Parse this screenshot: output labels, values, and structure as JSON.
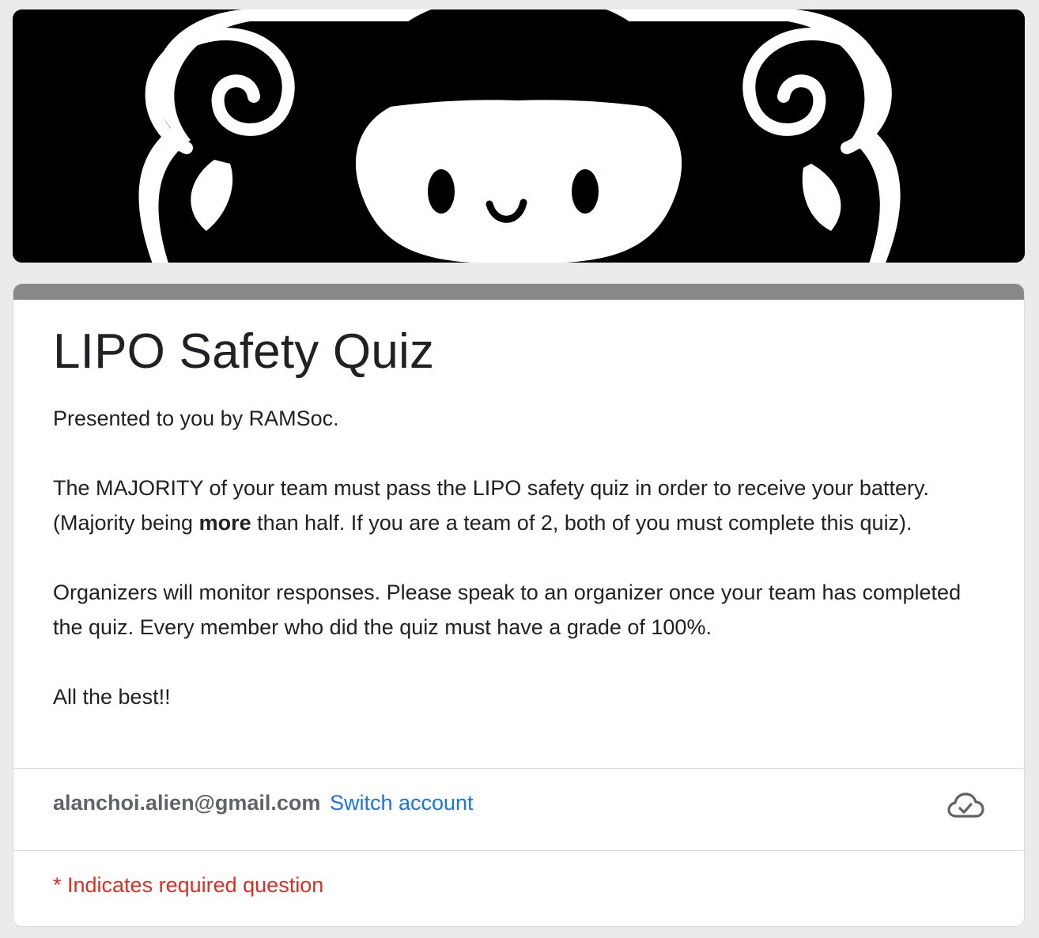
{
  "banner": {
    "icon": "ram-mascot-icon"
  },
  "form": {
    "title": "LIPO Safety Quiz",
    "description": {
      "p1": "Presented to you by RAMSoc.",
      "p2_before": "The MAJORITY of your team must pass the LIPO safety quiz in order to receive your battery. (Majority being ",
      "p2_bold": "more",
      "p2_after": " than half. If you are a team of 2, both of you must complete this quiz).",
      "p3": "Organizers will monitor responses. Please speak to an organizer once your team has completed the quiz. Every member who did the quiz must have a grade of 100%.",
      "p4": "All the best!!"
    }
  },
  "account": {
    "email": "alanchoi.alien@gmail.com",
    "switch_label": "Switch account",
    "status_icon": "cloud-check-icon"
  },
  "required_note": "* Indicates required question",
  "colors": {
    "page_bg": "#ebebeb",
    "accent_strip": "#888888",
    "link": "#1a73e8",
    "required": "#d93025"
  }
}
